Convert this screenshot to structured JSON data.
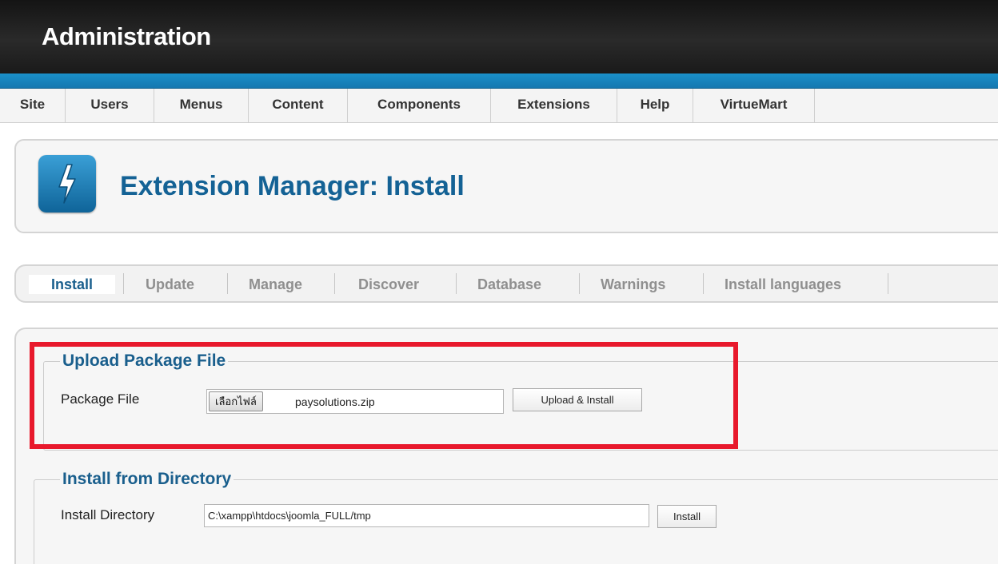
{
  "header": {
    "title": "Administration"
  },
  "menu": {
    "items": [
      {
        "label": "Site"
      },
      {
        "label": "Users"
      },
      {
        "label": "Menus"
      },
      {
        "label": "Content"
      },
      {
        "label": "Components"
      },
      {
        "label": "Extensions"
      },
      {
        "label": "Help"
      },
      {
        "label": "VirtueMart"
      }
    ]
  },
  "page": {
    "title": "Extension Manager: Install",
    "icon": "lightning-bolt-icon"
  },
  "submenu": {
    "items": [
      {
        "label": "Install",
        "active": true
      },
      {
        "label": "Update"
      },
      {
        "label": "Manage"
      },
      {
        "label": "Discover"
      },
      {
        "label": "Database"
      },
      {
        "label": "Warnings"
      },
      {
        "label": "Install languages"
      }
    ]
  },
  "upload": {
    "legend": "Upload Package File",
    "label": "Package File",
    "choose_label": "เลือกไฟล์",
    "file_name": "paysolutions.zip",
    "button_label": "Upload & Install"
  },
  "directory": {
    "legend": "Install from Directory",
    "label": "Install Directory",
    "value": "C:\\xampp\\htdocs\\joomla_FULL/tmp",
    "button_label": "Install"
  },
  "colors": {
    "accent_blue": "#146295",
    "header_blue": "#1a90c9",
    "highlight_red": "#e8192c"
  }
}
